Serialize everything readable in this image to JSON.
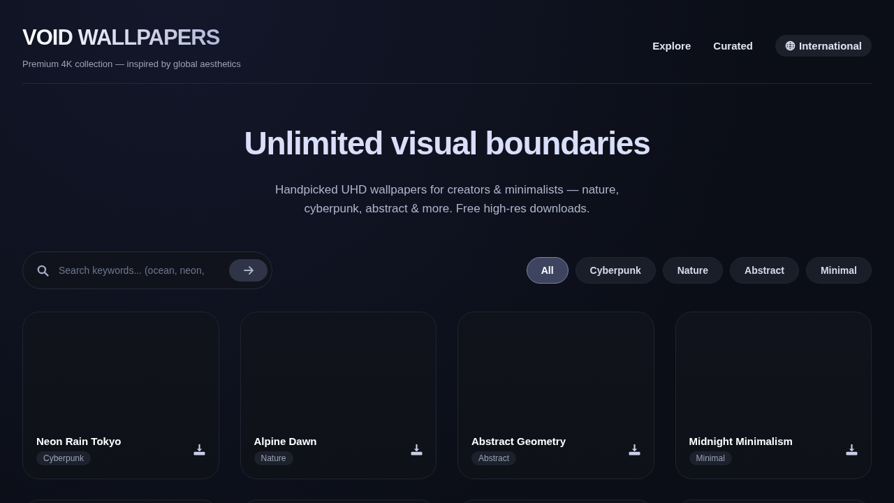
{
  "brand": {
    "title": "VOID WALLPAPERS",
    "tagline": "Premium 4K collection — inspired by global aesthetics"
  },
  "nav": [
    {
      "label": "Explore",
      "kind": "link"
    },
    {
      "label": "Curated",
      "kind": "link"
    },
    {
      "label": "International",
      "kind": "pill"
    }
  ],
  "hero": {
    "title": "Unlimited visual boundaries",
    "subtitle": "Handpicked UHD wallpapers for creators & minimalists — nature, cyberpunk, abstract & more. Free high-res downloads."
  },
  "search": {
    "placeholder": "Search keywords... (ocean, neon,"
  },
  "filters": [
    {
      "label": "All",
      "selected": true
    },
    {
      "label": "Cyberpunk",
      "selected": false
    },
    {
      "label": "Nature",
      "selected": false
    },
    {
      "label": "Abstract",
      "selected": false
    },
    {
      "label": "Minimal",
      "selected": false
    }
  ],
  "cards": [
    {
      "title": "Neon Rain Tokyo",
      "tag": "Cyberpunk"
    },
    {
      "title": "Alpine Dawn",
      "tag": "Nature"
    },
    {
      "title": "Abstract Geometry",
      "tag": "Abstract"
    },
    {
      "title": "Midnight Minimalism",
      "tag": "Minimal"
    }
  ]
}
